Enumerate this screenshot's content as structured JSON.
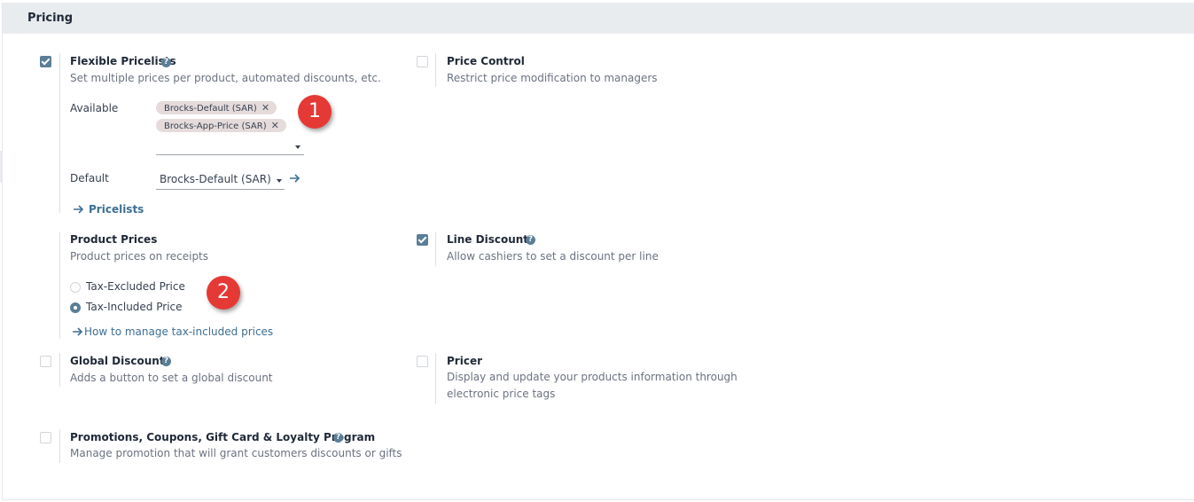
{
  "section": {
    "title": "Pricing"
  },
  "flexible_pricelists": {
    "title": "Flexible Pricelists",
    "description": "Set multiple prices per product, automated discounts, etc.",
    "checked": true,
    "available_label": "Available",
    "available_tags": [
      "Brocks-Default (SAR)",
      "Brocks-App-Price (SAR)"
    ],
    "tag_remove_glyph": "✕",
    "default_label": "Default",
    "default_value": "Brocks-Default (SAR)",
    "pricelists_link": "Pricelists"
  },
  "price_control": {
    "title": "Price Control",
    "description": "Restrict price modification to managers",
    "checked": false
  },
  "product_prices": {
    "title": "Product Prices",
    "description": "Product prices on receipts",
    "options": [
      "Tax-Excluded Price",
      "Tax-Included Price"
    ],
    "selected": "Tax-Included Price",
    "help_link": "How to manage tax-included prices"
  },
  "line_discounts": {
    "title": "Line Discounts",
    "description": "Allow cashiers to set a discount per line",
    "checked": true
  },
  "global_discounts": {
    "title": "Global Discounts",
    "description": "Adds a button to set a global discount",
    "checked": false
  },
  "pricer": {
    "title": "Pricer",
    "description": "Display and update your products information through electronic price tags",
    "checked": false
  },
  "promotions": {
    "title": "Promotions, Coupons, Gift Card & Loyalty Program",
    "description": "Manage promotion that will grant customers discounts or gifts",
    "checked": false
  },
  "markers": [
    "1",
    "2"
  ],
  "icons": {
    "help": "question-circle-icon",
    "arrow": "arrow-right-icon"
  },
  "colors": {
    "accent": "#5b7e97",
    "link": "#3d6f93",
    "marker": "#e53935",
    "header_bg": "#e9ecef"
  }
}
